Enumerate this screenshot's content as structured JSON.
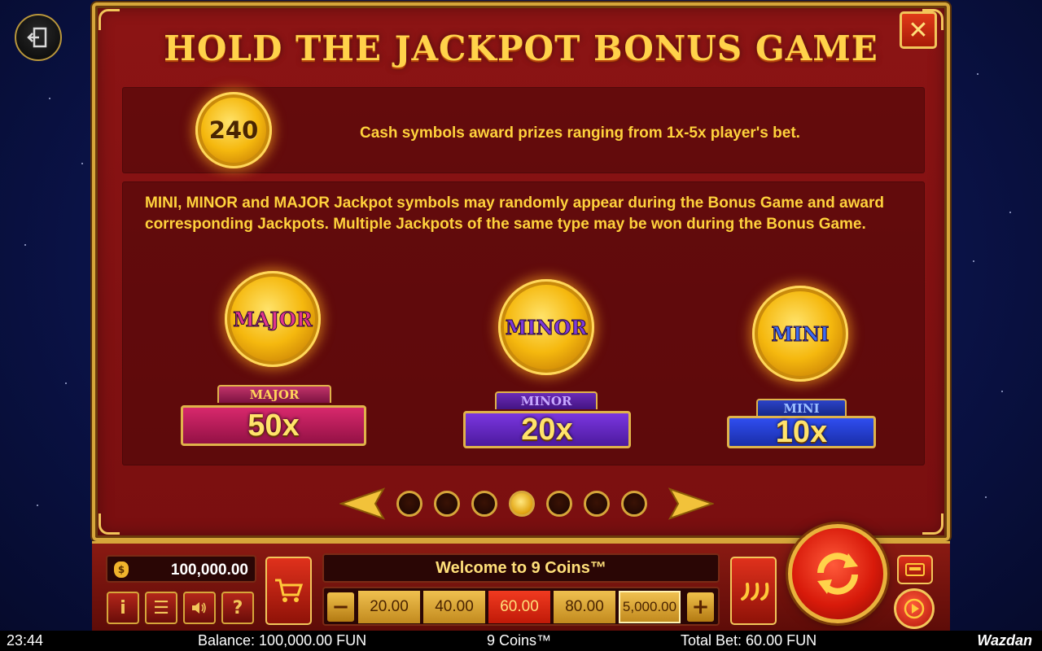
{
  "title": "HOLD THE JACKPOT BONUS GAME",
  "cash_coin_value": "240",
  "cash_text": "Cash symbols award prizes ranging from 1x-5x player's bet.",
  "jackpot_text": "MINI, MINOR and MAJOR Jackpot symbols may randomly appear during the Bonus Game and award corresponding Jackpots. Multiple Jackpots of the same type may be won during the Bonus Game.",
  "jackpots": [
    {
      "coin_word": "MAJOR",
      "tag": "MAJOR",
      "multiplier": "50x",
      "color": "#d8286c"
    },
    {
      "coin_word": "MINOR",
      "tag": "MINOR",
      "multiplier": "20x",
      "color": "#7a36e0"
    },
    {
      "coin_word": "MINI",
      "tag": "MINI",
      "multiplier": "10x",
      "color": "#2f4df0"
    }
  ],
  "pager": {
    "pages": 7,
    "current": 4
  },
  "controls": {
    "balance": "100,000.00",
    "welcome": "Welcome  to 9 Coins™",
    "minus": "−",
    "plus": "+",
    "bets": [
      "20.00",
      "40.00",
      "60.00",
      "80.00",
      "5,000.00"
    ],
    "selected_bet": "60.00",
    "buttons": {
      "info": "i",
      "menu": "☰",
      "sound": "🔈",
      "help": "?"
    }
  },
  "status_bar": {
    "time": "23:44",
    "balance": "Balance: 100,000.00 FUN",
    "game": "9 Coins™",
    "total_bet": "Total Bet: 60.00 FUN",
    "brand": "Wazdan"
  },
  "icons": {
    "exit": "exit-icon",
    "close": "close-icon",
    "cart": "cart-icon",
    "turbo": "chili-icon",
    "spin": "spin-arrows-icon",
    "autoplay": "play-icon",
    "money_bag": "money-bag-icon"
  }
}
